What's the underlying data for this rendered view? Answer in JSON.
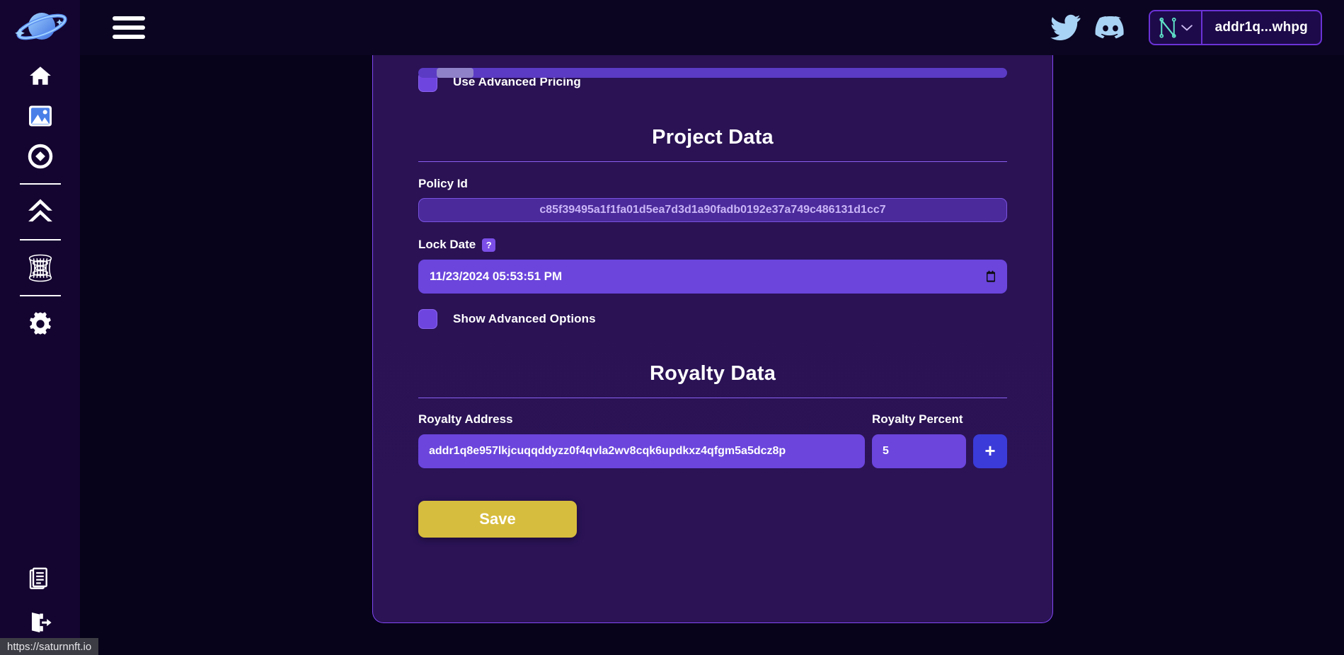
{
  "app": {
    "brand_icon": "saturn-planet-logo",
    "background_color": "#07031a",
    "card_color": "#2a1254",
    "accent_purple": "#6b45dc",
    "accent_blue": "#3b3bd9",
    "save_color": "#d7bd3d"
  },
  "sidebar": {
    "items": [
      {
        "id": "home",
        "icon": "home-icon",
        "label": "Home"
      },
      {
        "id": "gallery",
        "icon": "image-icon",
        "label": "Gallery"
      },
      {
        "id": "token",
        "icon": "target-circle-icon",
        "label": "Token"
      },
      {
        "id": "mint",
        "icon": "double-chevron-up-icon",
        "label": "Mint"
      },
      {
        "id": "portal",
        "icon": "wormhole-icon",
        "label": "Portal"
      },
      {
        "id": "settings",
        "icon": "gear-icon",
        "label": "Settings"
      }
    ],
    "bottom_items": [
      {
        "id": "docs",
        "icon": "documents-icon",
        "label": "Docs"
      },
      {
        "id": "logout",
        "icon": "logout-icon",
        "label": "Logout"
      }
    ]
  },
  "topbar": {
    "menu_icon": "hamburger-icon",
    "twitter_icon": "twitter-icon",
    "discord_icon": "discord-icon",
    "wallet": {
      "provider_icon": "nami-wallet-icon",
      "chevron_icon": "chevron-down-icon",
      "address": "addr1q...whpg"
    }
  },
  "form": {
    "advanced_pricing": {
      "label": "Use Advanced Pricing",
      "checked": false
    },
    "project_data": {
      "heading": "Project Data",
      "policy_id": {
        "label": "Policy Id",
        "value": "c85f39495a1f1fa01d5ea7d3d1a90fadb0192e37a749c486131d1cc7"
      },
      "lock_date": {
        "label": "Lock Date",
        "help_badge": "?",
        "value": "11/23/2024 05:53:51 PM",
        "picker_icon": "calendar-icon"
      },
      "show_advanced": {
        "label": "Show Advanced Options",
        "checked": false
      }
    },
    "royalty_data": {
      "heading": "Royalty Data",
      "address": {
        "label": "Royalty Address",
        "value": "addr1q8e957lkjcuqqddyzz0f4qvla2wv8cqk6updkxz4qfgm5a5dcz8p"
      },
      "percent": {
        "label": "Royalty Percent",
        "value": "5"
      },
      "add_button": {
        "label": "+",
        "icon": "plus-icon"
      }
    },
    "save_button": {
      "label": "Save"
    }
  },
  "status_bar": {
    "url": "https://saturnnft.io"
  }
}
